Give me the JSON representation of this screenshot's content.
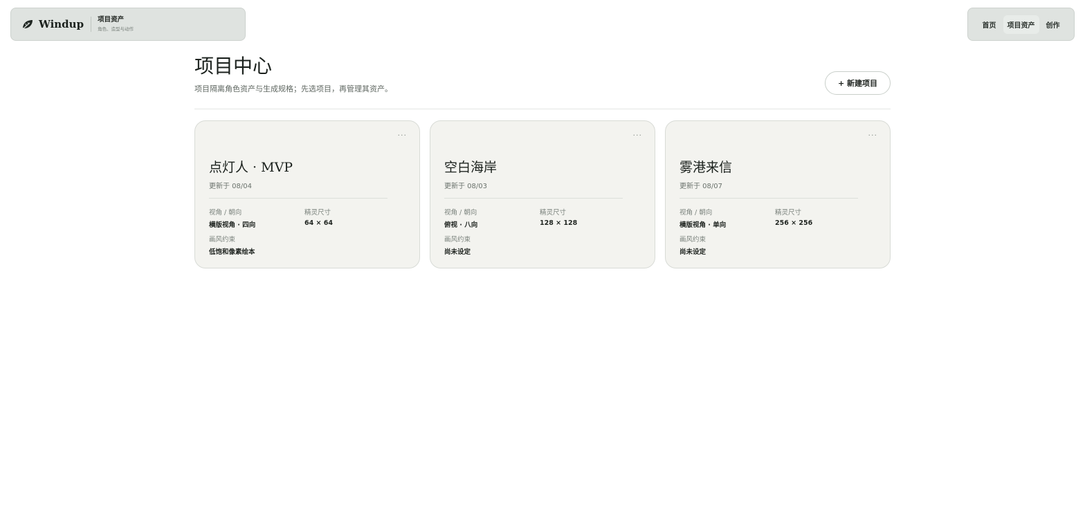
{
  "header": {
    "brand": "Windup",
    "section_title": "项目资产",
    "section_subtitle": "角色、造型与动作",
    "logo_icon": "leaf-logo-icon"
  },
  "nav": {
    "items": [
      {
        "label": "首页",
        "active": false
      },
      {
        "label": "项目资产",
        "active": true
      },
      {
        "label": "创作",
        "active": false
      }
    ]
  },
  "page": {
    "title": "项目中心",
    "description": "项目隔离角色资产与生成规格；先选项目，再管理其资产。",
    "new_button_label": "+ 新建项目"
  },
  "labels": {
    "view": "视角 / 朝向",
    "sprite_size": "精灵尺寸",
    "style": "画风约束",
    "menu": "···"
  },
  "projects": [
    {
      "title": "点灯人 · MVP",
      "updated": "更新于 08/04",
      "view": "横版视角 · 四向",
      "sprite_size": "64 × 64",
      "style": "低饱和像素绘本"
    },
    {
      "title": "空白海岸",
      "updated": "更新于 08/03",
      "view": "俯视 · 八向",
      "sprite_size": "128 × 128",
      "style": "尚未设定"
    },
    {
      "title": "雾港来信",
      "updated": "更新于 08/07",
      "view": "横版视角 · 单向",
      "sprite_size": "256 × 256",
      "style": "尚未设定"
    }
  ],
  "colors": {
    "topbar_bg": "#dfe3e0",
    "card_bg": "#f3f3ef",
    "active_nav_bg": "#e8ece9"
  }
}
